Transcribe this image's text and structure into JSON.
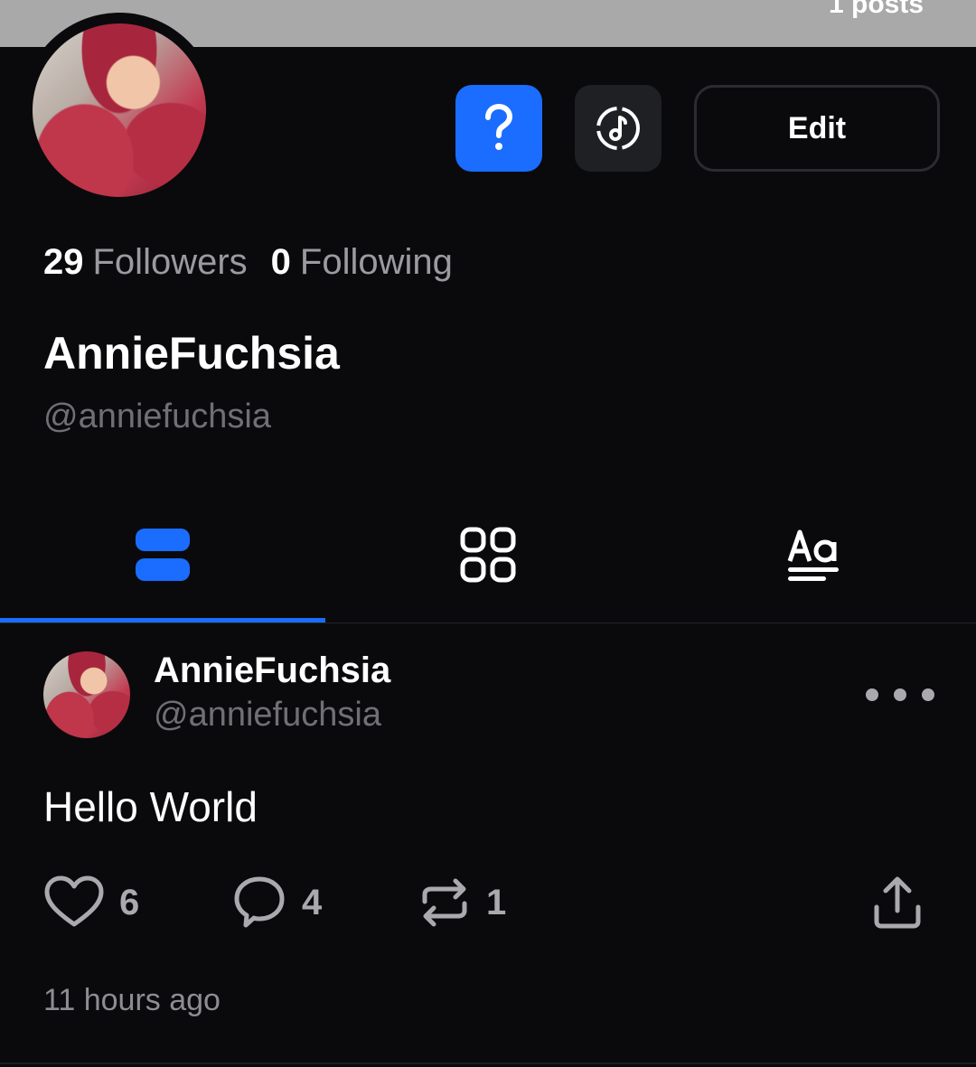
{
  "banner": {
    "posts_label": "1 posts"
  },
  "header": {
    "help_icon": "question-mark-icon",
    "music_icon": "music-disc-icon",
    "edit_label": "Edit"
  },
  "stats": {
    "followers_count": "29",
    "followers_label": "Followers",
    "following_count": "0",
    "following_label": "Following"
  },
  "profile": {
    "display_name": "AnnieFuchsia",
    "handle": "@anniefuchsia"
  },
  "tabs": [
    {
      "icon": "list-view-icon",
      "active": true
    },
    {
      "icon": "grid-view-icon",
      "active": false
    },
    {
      "icon": "text-view-icon",
      "active": false
    }
  ],
  "post": {
    "author_name": "AnnieFuchsia",
    "author_handle": "@anniefuchsia",
    "text": "Hello World",
    "likes": "6",
    "comments": "4",
    "reposts": "1",
    "time_ago": "11 hours ago"
  },
  "colors": {
    "background": "#0a0a0c",
    "accent": "#1a6dff",
    "muted_text": "#6f6f75",
    "icon_gray": "#a9a9ae"
  }
}
